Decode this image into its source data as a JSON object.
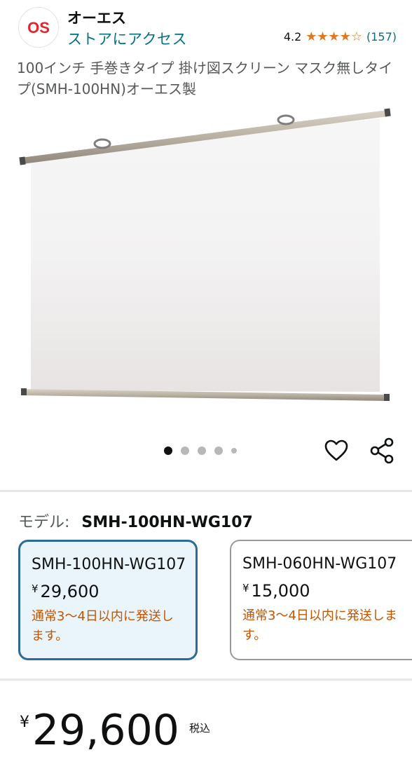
{
  "brand": {
    "logo_text": "OS",
    "name": "オーエス",
    "store_link": "ストアにアクセス"
  },
  "rating": {
    "average": "4.2",
    "stars": 4.2,
    "count": "(157)",
    "star_color": "#de7921"
  },
  "product": {
    "title": "100インチ 手巻きタイプ 掛け図スクリーン マスク無しタイプ(SMH-100HN)オーエス製"
  },
  "carousel": {
    "total_dots": 5,
    "active_index": 0
  },
  "icons": {
    "wishlist": "heart-icon",
    "share": "share-icon"
  },
  "model": {
    "label": "モデル:",
    "selected": "SMH-100HN-WG107"
  },
  "variants": [
    {
      "name": "SMH-100HN-WG107",
      "currency": "¥",
      "price": "29,600",
      "shipping": "通常3〜4日以内に発送します。",
      "selected": true
    },
    {
      "name": "SMH-060HN-WG107",
      "currency": "¥",
      "price": "15,000",
      "shipping": "通常3〜4日以内に発送します。",
      "selected": false
    }
  ],
  "price": {
    "currency": "¥",
    "amount": "29,600",
    "tax_note": "税込"
  },
  "colors": {
    "link": "#007185",
    "selected_border": "#2e6a97",
    "shipping_text": "#c45500",
    "logo_red": "#e3262e"
  }
}
